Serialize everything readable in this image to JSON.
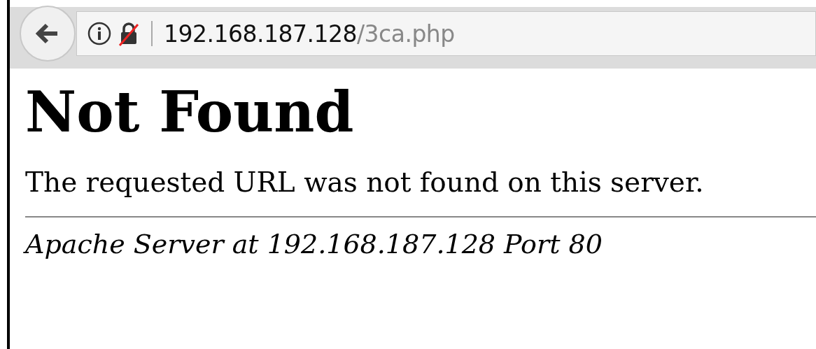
{
  "toolbar": {
    "url": {
      "host": "192.168.187.128",
      "path": "/3ca.php"
    },
    "insecure": true
  },
  "page": {
    "heading": "Not Found",
    "message": "The requested URL was not found on this server.",
    "address": "Apache Server at 192.168.187.128 Port 80"
  }
}
